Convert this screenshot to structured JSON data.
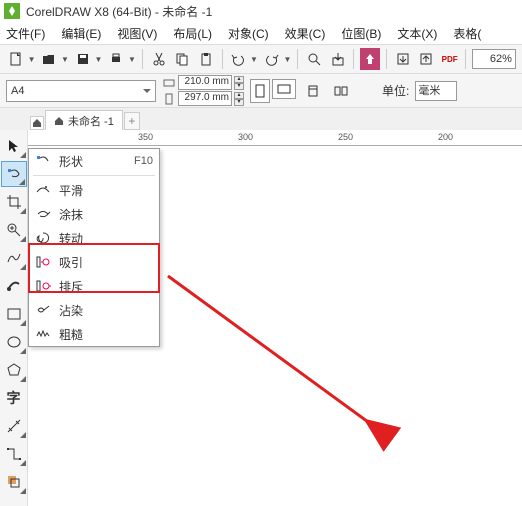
{
  "app": {
    "title": "CorelDRAW X8 (64-Bit) - 未命名 -1"
  },
  "menu": [
    "文件(F)",
    "编辑(E)",
    "视图(V)",
    "布局(L)",
    "对象(C)",
    "效果(C)",
    "位图(B)",
    "文本(X)",
    "表格("
  ],
  "toolbar": {
    "zoom": "62%"
  },
  "page": {
    "preset": "A4",
    "width": "210.0 mm",
    "height": "297.0 mm",
    "unit_label": "单位:",
    "unit_value": "毫米"
  },
  "tabs": {
    "doc": "未命名 -1",
    "add": "+"
  },
  "ruler_ticks": [
    "350",
    "300",
    "250",
    "200"
  ],
  "flyout": {
    "items": [
      {
        "label": "形状",
        "key": "F10"
      },
      {
        "label": "平滑",
        "key": ""
      },
      {
        "label": "涂抹",
        "key": ""
      },
      {
        "label": "转动",
        "key": ""
      },
      {
        "label": "吸引",
        "key": ""
      },
      {
        "label": "排斥",
        "key": ""
      },
      {
        "label": "沾染",
        "key": ""
      },
      {
        "label": "粗糙",
        "key": ""
      }
    ]
  }
}
